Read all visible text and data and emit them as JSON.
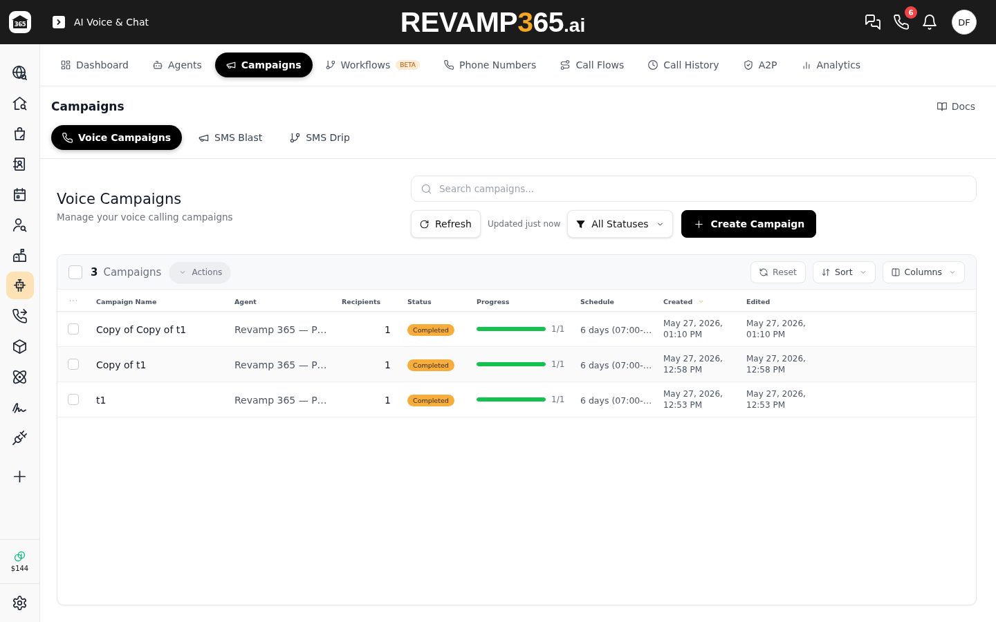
{
  "top_bar": {
    "logo_text": "365",
    "app_title": "AI Voice & Chat",
    "brand": {
      "name": "REVAMP",
      "accent": "3",
      "number": "65",
      "suffix": ".ai"
    },
    "call_badge": "6",
    "avatar": "DF"
  },
  "sidebar": {
    "items": [
      {
        "selected": false
      },
      {
        "selected": false
      },
      {
        "selected": false
      },
      {
        "selected": false
      },
      {
        "selected": false
      },
      {
        "selected": false
      },
      {
        "selected": false
      },
      {
        "selected": true
      },
      {
        "selected": false
      },
      {
        "selected": false
      },
      {
        "selected": false
      },
      {
        "selected": false
      },
      {
        "selected": false
      }
    ],
    "credits": "$144"
  },
  "nav_tabs": [
    {
      "label": "Dashboard",
      "selected": false
    },
    {
      "label": "Agents",
      "selected": false
    },
    {
      "label": "Campaigns",
      "selected": true
    },
    {
      "label": "Workflows",
      "selected": false,
      "badge": "BETA"
    },
    {
      "label": "Phone Numbers",
      "selected": false
    },
    {
      "label": "Call Flows",
      "selected": false
    },
    {
      "label": "Call History",
      "selected": false
    },
    {
      "label": "A2P",
      "selected": false
    },
    {
      "label": "Analytics",
      "selected": false
    }
  ],
  "section": {
    "title": "Campaigns",
    "docs_link": "Docs",
    "tabs": [
      {
        "label": "Voice Campaigns",
        "selected": true
      },
      {
        "label": "SMS Blast",
        "selected": false
      },
      {
        "label": "SMS Drip",
        "selected": false
      }
    ]
  },
  "page_header": {
    "title": "Voice Campaigns",
    "subtitle": "Manage your voice calling campaigns"
  },
  "search": {
    "placeholder": "Search campaigns..."
  },
  "toolbar": {
    "refresh": "Refresh",
    "updated": "Updated just now",
    "status_filter": "All Statuses",
    "create": "Create Campaign"
  },
  "table": {
    "select_all": {
      "checked": false
    },
    "count": "3",
    "count_label": "Campaigns",
    "actions": "Actions",
    "reset": "Reset",
    "sort": "Sort",
    "columns_button": "Columns",
    "columns": [
      {
        "label": "Campaign Name",
        "sorted": false
      },
      {
        "label": "Agent",
        "sorted": false
      },
      {
        "label": "Recipients",
        "sorted": false
      },
      {
        "label": "Status",
        "sorted": false
      },
      {
        "label": "Progress",
        "sorted": false
      },
      {
        "label": "Schedule",
        "sorted": false
      },
      {
        "label": "Created",
        "sorted": true
      },
      {
        "label": "Edited",
        "sorted": false
      }
    ],
    "rows": [
      {
        "checked": false,
        "name": "Copy of Copy of t1",
        "agent": "Revamp 365 — P…",
        "recipients": "1",
        "status": {
          "label": "Completed",
          "color": "#f6ad3c"
        },
        "level": 1,
        "progress": "1/1",
        "schedule": "6 days (07:00-…",
        "created": "May 27, 2026, 01:10 PM",
        "edited": "May 27, 2026, 01:10 PM"
      },
      {
        "checked": false,
        "name": "Copy of t1",
        "agent": "Revamp 365 — P…",
        "recipients": "1",
        "status": {
          "label": "Completed",
          "color": "#f6ad3c"
        },
        "level": 1,
        "progress": "1/1",
        "schedule": "6 days (07:00-…",
        "created": "May 27, 2026, 12:58 PM",
        "edited": "May 27, 2026, 12:58 PM"
      },
      {
        "checked": false,
        "name": "t1",
        "agent": "Revamp 365 — P…",
        "recipients": "1",
        "status": {
          "label": "Completed",
          "color": "#f6ad3c"
        },
        "level": 1,
        "progress": "1/1",
        "schedule": "6 days (07:00-…",
        "created": "May 27, 2026, 12:53 PM",
        "edited": "May 27, 2026, 12:53 PM"
      }
    ]
  }
}
